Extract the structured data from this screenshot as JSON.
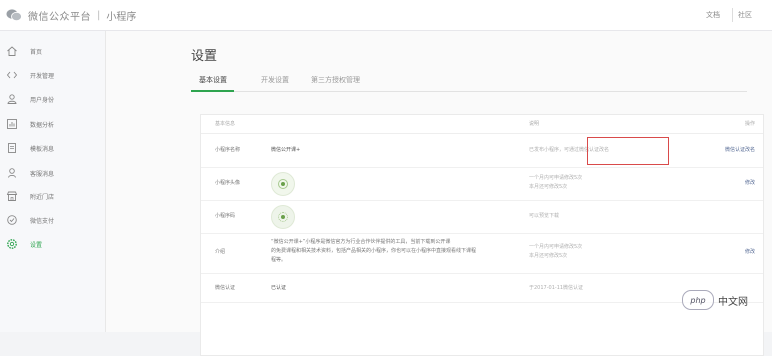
{
  "header": {
    "brand": "微信公众平台",
    "separator": "|",
    "product": "小程序",
    "links": [
      "文档",
      "社区"
    ]
  },
  "sidebar": {
    "items": [
      {
        "label": "首页",
        "icon": "home-icon"
      },
      {
        "label": "开发管理",
        "icon": "code-icon"
      },
      {
        "label": "用户身份",
        "icon": "user-icon"
      },
      {
        "label": "数据分析",
        "icon": "chart-icon"
      },
      {
        "label": "模板消息",
        "icon": "document-icon"
      },
      {
        "label": "客服消息",
        "icon": "person-icon"
      },
      {
        "label": "附近门店",
        "icon": "store-icon"
      },
      {
        "label": "微信支付",
        "icon": "payment-icon"
      },
      {
        "label": "设置",
        "icon": "settings-icon",
        "active": true
      }
    ]
  },
  "page": {
    "title": "设置"
  },
  "tabs": [
    "基本设置",
    "开发设置",
    "第三方授权管理"
  ],
  "table": {
    "headers": [
      "基本信息",
      "说明",
      "操作"
    ],
    "rows": [
      {
        "label": "小程序名称",
        "value": "微信公开课+",
        "desc": "已发布小程序，可通过微信认证改名",
        "op": "微信认证改名"
      },
      {
        "label": "小程序头像",
        "desc_lines": [
          "一个月内可申请修改5次",
          "本月还可修改5次"
        ],
        "op": "修改"
      },
      {
        "label": "小程序码",
        "desc": "可以预览下载"
      },
      {
        "label": "介绍",
        "value_lines": [
          "“微信公开课+”小程序是微信官方为行业合作伙伴提供的工具，当前下载到公开课",
          "的免费课程和相关技术资料，包括产品相关的小程序，你也可以在小程序中直接观看线下课程",
          "程等。"
        ],
        "desc_lines": [
          "一个月内可申请修改5次",
          "本月还可修改5次"
        ],
        "op": "修改"
      },
      {
        "label": "微信认证",
        "value": "已认证",
        "desc": "于2017-01-11微信认证"
      }
    ]
  },
  "watermark": {
    "badge": "php",
    "text": "中文网"
  },
  "colors": {
    "accent": "#2ea44f",
    "highlight": "#d94a4a"
  }
}
